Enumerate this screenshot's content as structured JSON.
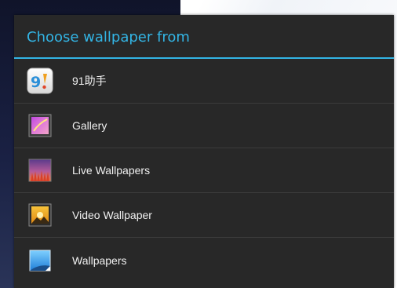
{
  "dialog": {
    "title": "Choose wallpaper from",
    "accent_color": "#33b5e5",
    "items": [
      {
        "label": "91助手",
        "icon": "91-assistant-app-icon"
      },
      {
        "label": "Gallery",
        "icon": "gallery-app-icon"
      },
      {
        "label": "Live Wallpapers",
        "icon": "live-wallpapers-app-icon"
      },
      {
        "label": "Video Wallpaper",
        "icon": "video-wallpaper-app-icon"
      },
      {
        "label": "Wallpapers",
        "icon": "wallpapers-app-icon"
      }
    ]
  }
}
